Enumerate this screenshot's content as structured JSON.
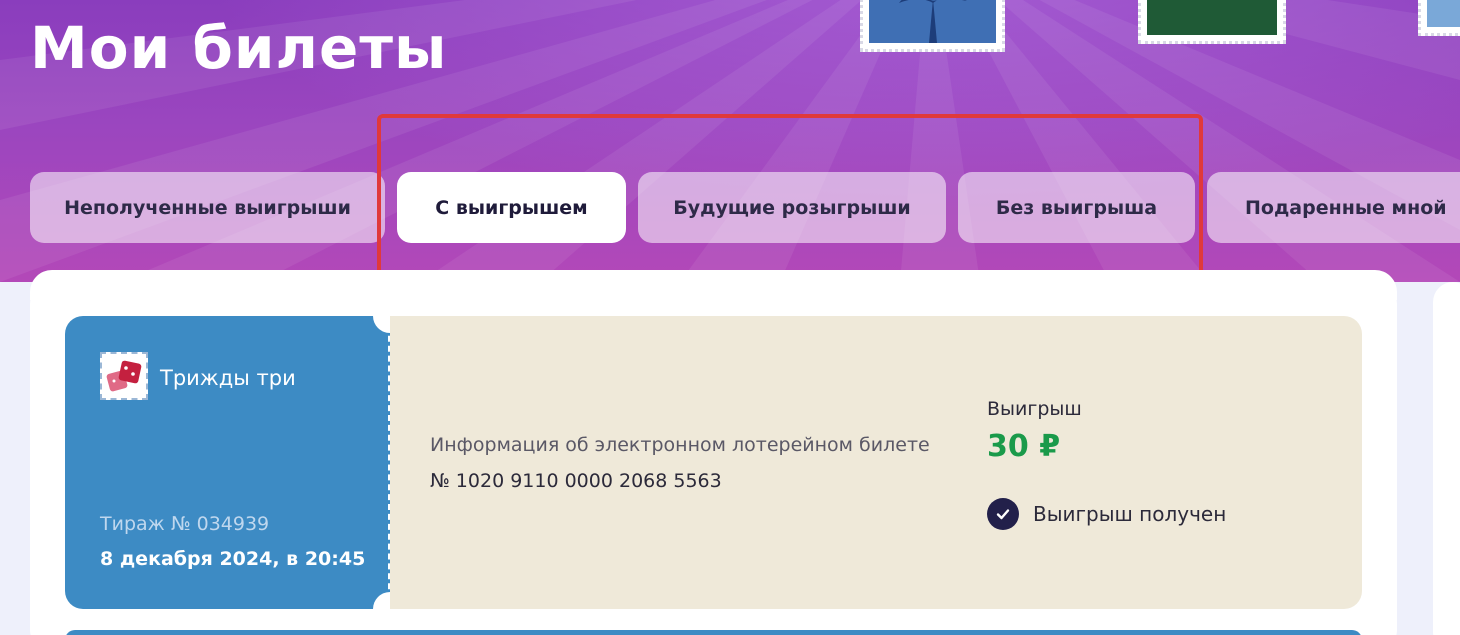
{
  "page": {
    "title": "Мои билеты"
  },
  "tabs": [
    {
      "label": "Неполученные выигрыши",
      "active": false
    },
    {
      "label": "С выигрышем",
      "active": true
    },
    {
      "label": "Будущие розыгрыши",
      "active": false
    },
    {
      "label": "Без выигрыша",
      "active": false
    },
    {
      "label": "Подаренные мной",
      "active": false
    }
  ],
  "ticket": {
    "game_name": "Трижды три",
    "draw_number": "Тираж № 034939",
    "draw_date": "8 декабря 2024, в 20:45",
    "info_label": "Информация об электронном лотерейном билете",
    "ticket_number": "№ 1020 9110 0000 2068 5563",
    "win_label": "Выигрыш",
    "win_amount": "30 ₽",
    "status": "Выигрыш получен"
  },
  "colors": {
    "hero_top": "#8a3dbd",
    "hero_bottom": "#b348b8",
    "stub_blue": "#3d8bc4",
    "ticket_body": "#efe9d9",
    "win_green": "#1a9a4a",
    "highlight_red": "#e0393b"
  },
  "icons": {
    "game": "dice-icon",
    "status": "check-circle-icon"
  }
}
